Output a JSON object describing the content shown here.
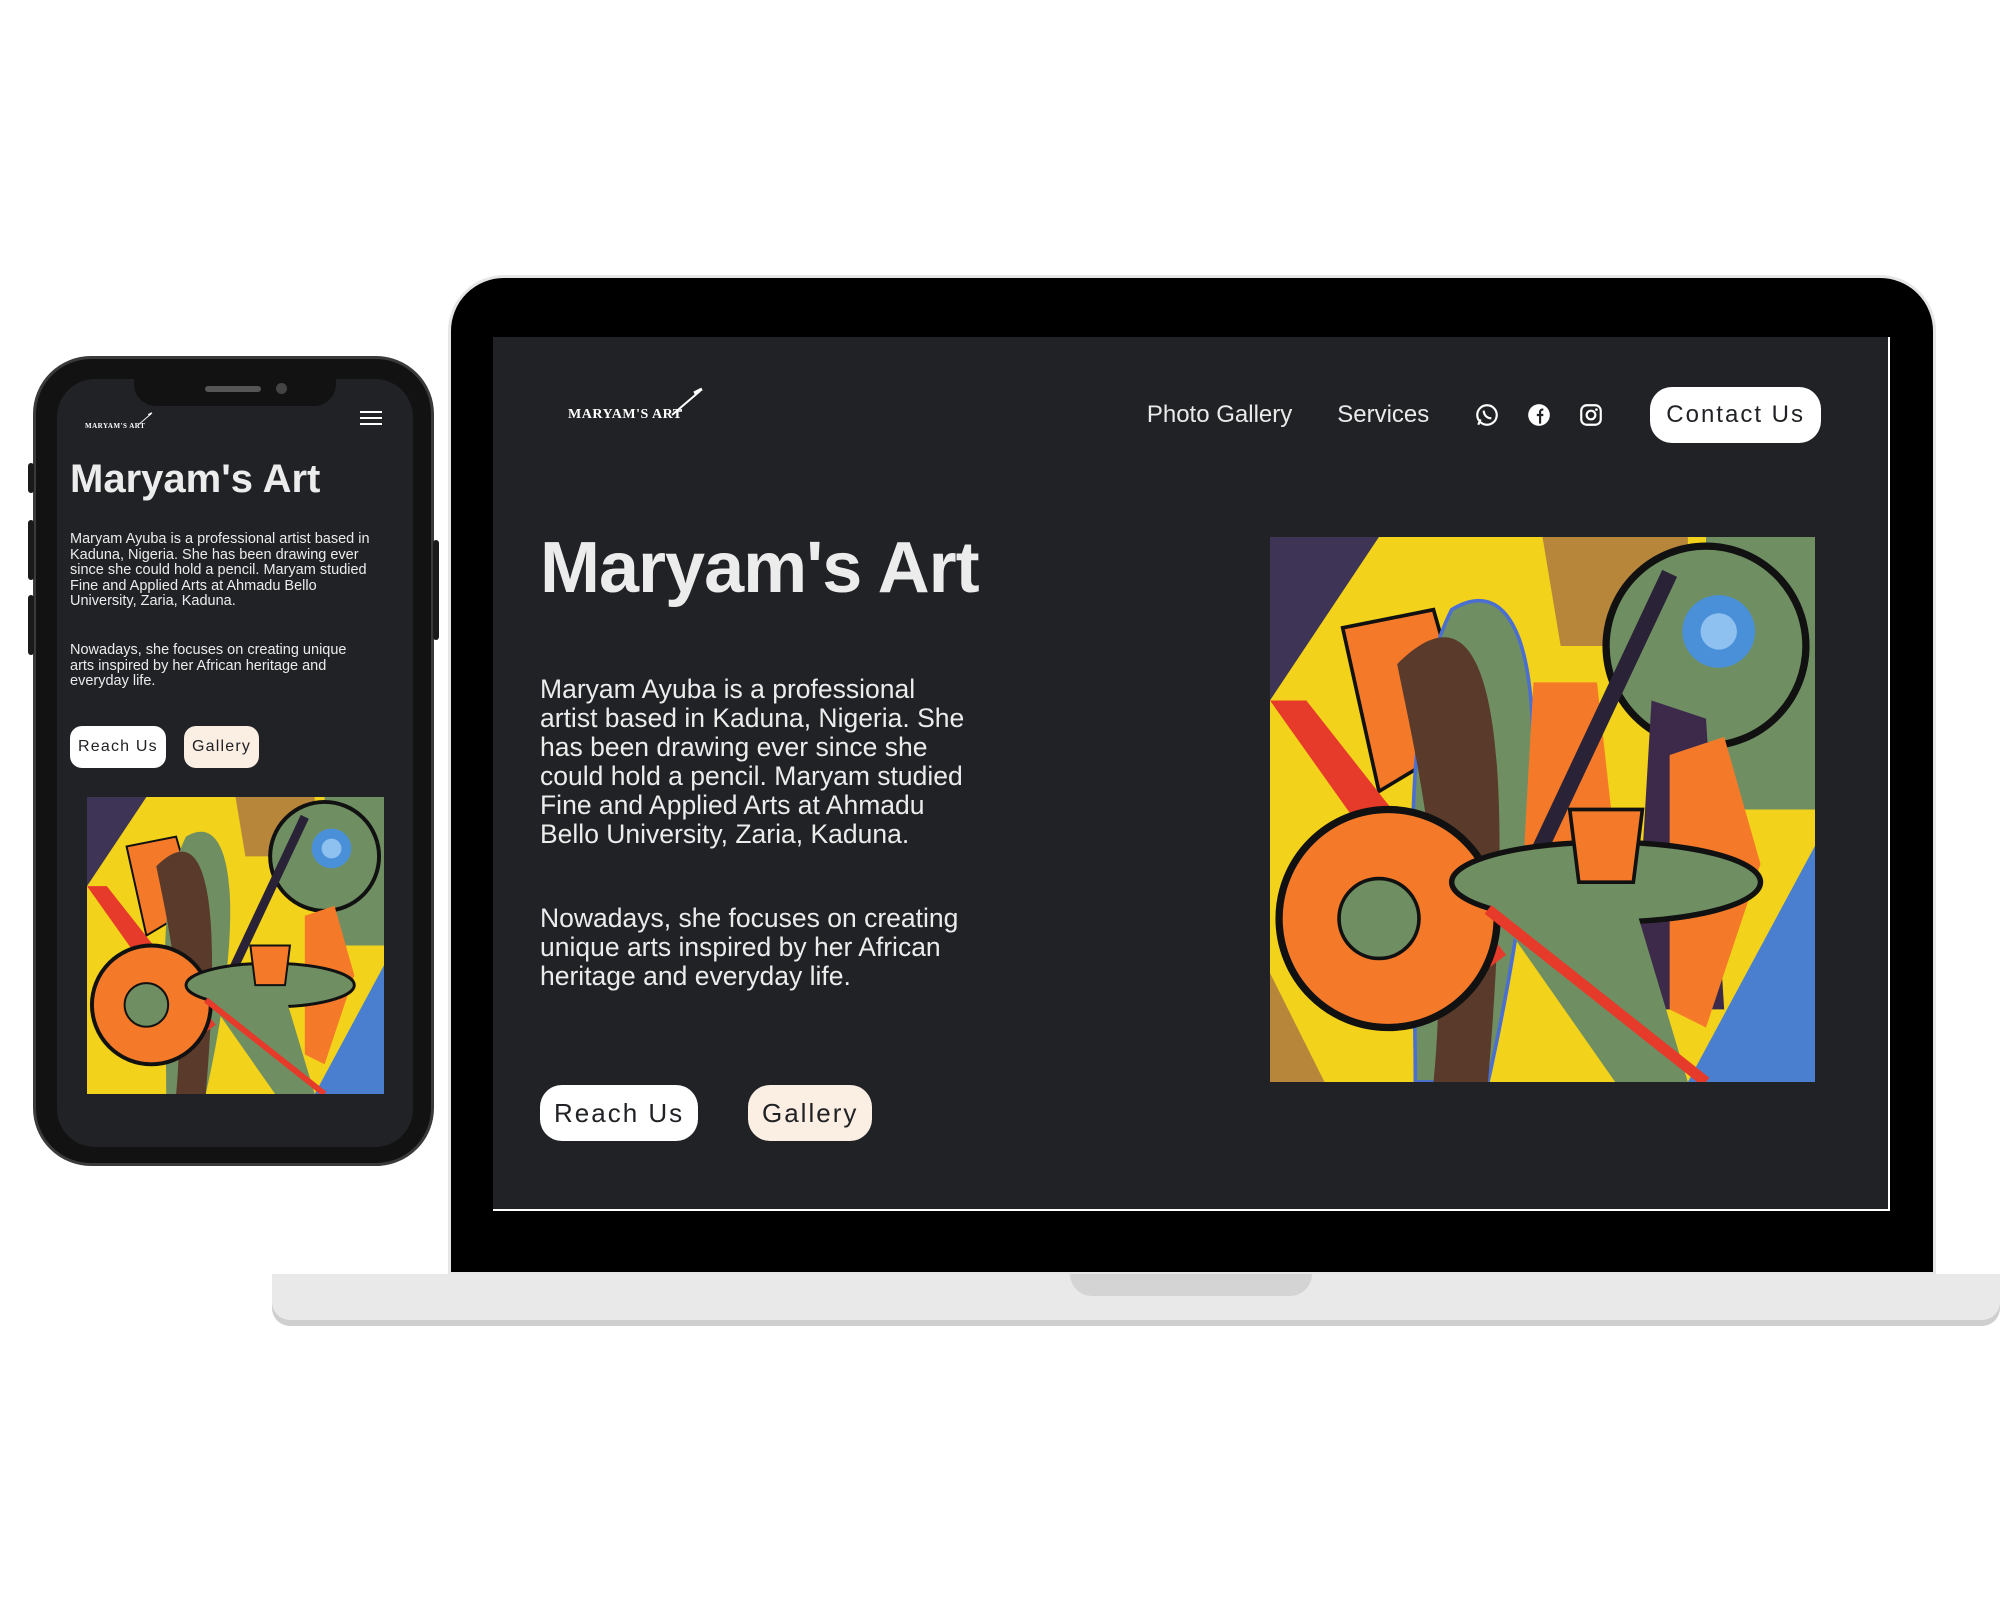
{
  "brand": {
    "logo_text": "MARYAM'S ART"
  },
  "nav": {
    "photo_gallery": "Photo Gallery",
    "services": "Services",
    "contact": "Contact Us"
  },
  "hero": {
    "title": "Maryam's Art",
    "paragraph1": "Maryam Ayuba is a professional artist based in Kaduna, Nigeria. She has been drawing ever since she could hold a pencil. Maryam studied Fine and Applied Arts at Ahmadu Bello University, Zaria, Kaduna.",
    "paragraph2": "Nowadays, she focuses on creating unique arts inspired by her African heritage and everyday life.",
    "reach_button": "Reach Us",
    "gallery_button": "Gallery"
  },
  "social_icons": [
    "whatsapp-icon",
    "facebook-icon",
    "instagram-icon"
  ],
  "colors": {
    "page_bg": "#202225",
    "text": "#ececec",
    "button_white": "#ffffff",
    "button_cream": "#fbeee3"
  }
}
